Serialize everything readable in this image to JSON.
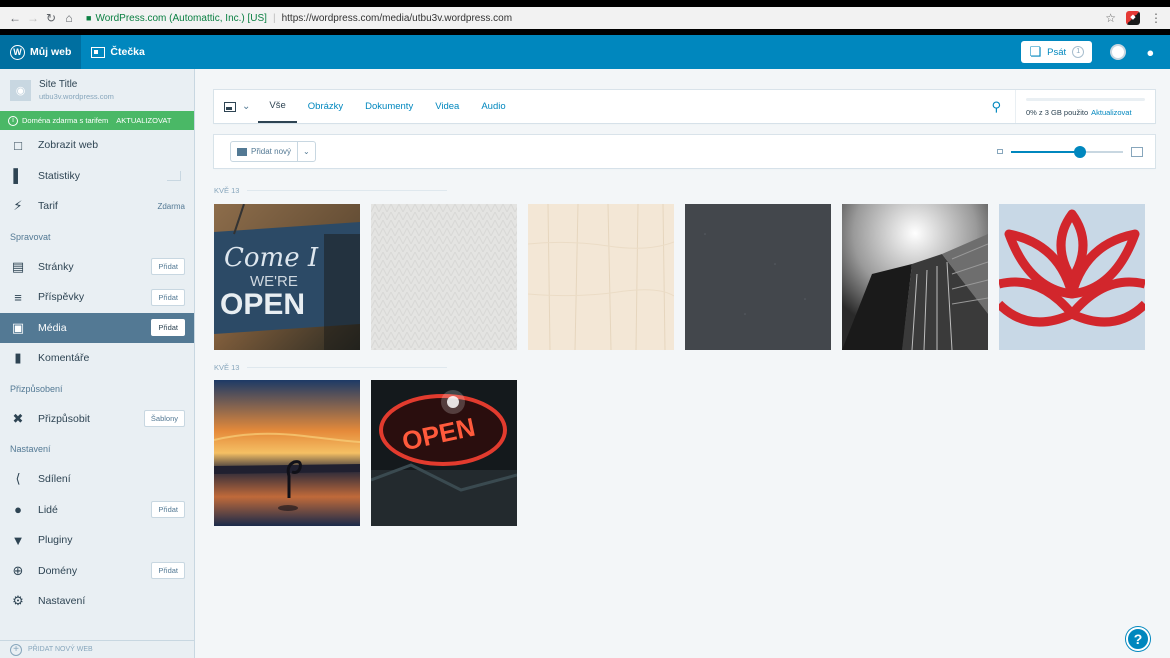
{
  "browser": {
    "secure_label": "WordPress.com (Automattic, Inc.) [US]",
    "url": "https://wordpress.com/media/utbu3v.wordpress.com"
  },
  "masterbar": {
    "my_sites": "Můj web",
    "reader": "Čtečka",
    "write": "Psát",
    "write_count": "1"
  },
  "sidebar": {
    "site_title": "Site Title",
    "site_url": "utbu3v.wordpress.com",
    "upsell_text": "Doména zdarma s tarifem",
    "upsell_action": "AKTUALIZOVAT",
    "items_top": [
      {
        "label": "Zobrazit web",
        "icon": "monitor-icon"
      },
      {
        "label": "Statistiky",
        "icon": "stats-icon"
      },
      {
        "label": "Tarif",
        "icon": "plan-icon",
        "extra": "Zdarma"
      }
    ],
    "section_manage": "Spravovat",
    "items_manage": [
      {
        "label": "Stránky",
        "icon": "pages-icon",
        "button": "Přidat"
      },
      {
        "label": "Příspěvky",
        "icon": "posts-icon",
        "button": "Přidat"
      },
      {
        "label": "Média",
        "icon": "media-icon",
        "button": "Přidat"
      },
      {
        "label": "Komentáře",
        "icon": "comments-icon"
      }
    ],
    "section_personalize": "Přizpůsobení",
    "items_personalize": [
      {
        "label": "Přizpůsobit",
        "icon": "customize-icon",
        "button": "Šablony"
      }
    ],
    "section_settings": "Nastavení",
    "items_settings": [
      {
        "label": "Sdílení",
        "icon": "share-icon"
      },
      {
        "label": "Lidé",
        "icon": "people-icon",
        "button": "Přidat"
      },
      {
        "label": "Pluginy",
        "icon": "plugin-icon"
      },
      {
        "label": "Domény",
        "icon": "globe-icon",
        "button": "Přidat"
      },
      {
        "label": "Nastavení",
        "icon": "gear-icon"
      }
    ],
    "add_site": "PŘIDAT NOVÝ WEB"
  },
  "filters": {
    "tabs": [
      "Vše",
      "Obrázky",
      "Dokumenty",
      "Videa",
      "Audio"
    ],
    "active_tab": "Vše"
  },
  "storage": {
    "used_text": "0% z 3 GB použito",
    "upgrade": "Aktualizovat",
    "used_fraction": 0.0
  },
  "actions": {
    "add_new": "Přidat nový"
  },
  "zoom": {
    "level_fraction": 0.62
  },
  "media": {
    "groups": [
      {
        "date": "KVĚ 13",
        "items": [
          "come-in-open-sign",
          "white-texture",
          "cream-wood-texture",
          "dark-grey-texture",
          "skyscraper-bw",
          "red-lotus-logo"
        ]
      },
      {
        "date": "KVĚ 13",
        "items": [
          "sunset-flamingo",
          "neon-open-sign"
        ]
      }
    ]
  },
  "colors": {
    "masterbar": "#0087be",
    "sidebar_selected": "#537994",
    "upsell": "#4ab866",
    "lotus_red": "#d2262c"
  }
}
